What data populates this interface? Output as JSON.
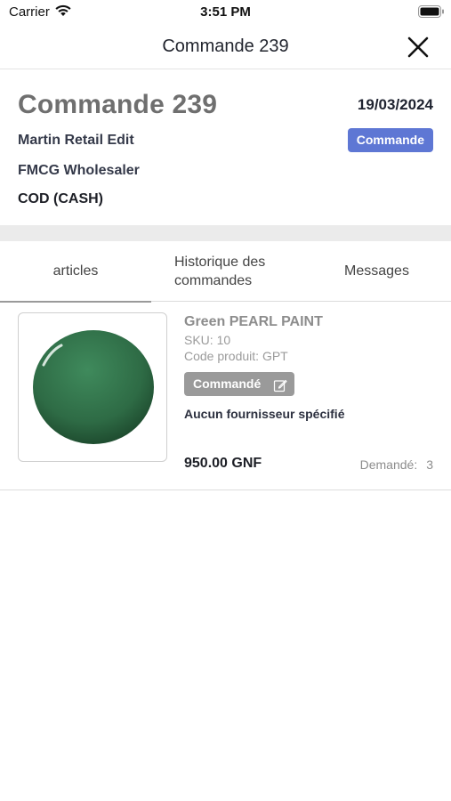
{
  "status_bar": {
    "carrier": "Carrier",
    "time": "3:51 PM"
  },
  "nav": {
    "title": "Commande 239",
    "close_icon": "close-icon"
  },
  "order": {
    "number_label": "Commande 239",
    "date": "19/03/2024",
    "customer": "Martin Retail Edit",
    "status": "Commande",
    "supplier_type": "FMCG Wholesaler",
    "payment": "COD (CASH)"
  },
  "tabs": [
    {
      "label": "articles",
      "active": true
    },
    {
      "label": "Historique des commandes",
      "active": false
    },
    {
      "label": "Messages",
      "active": false
    }
  ],
  "products": [
    {
      "name": "Green PEARL PAINT",
      "sku": "SKU: 10",
      "code": "Code produit: GPT",
      "status": "Commandé",
      "supplier_note": "Aucun fournisseur spécifié",
      "price": "950.00 GNF",
      "requested_label": "Demandé:",
      "requested_qty": "3",
      "image_color": "#2e6b45"
    }
  ],
  "colors": {
    "badge": "#5e77d4",
    "status_button": "#9a9a9a",
    "divider": "#ebebeb"
  }
}
